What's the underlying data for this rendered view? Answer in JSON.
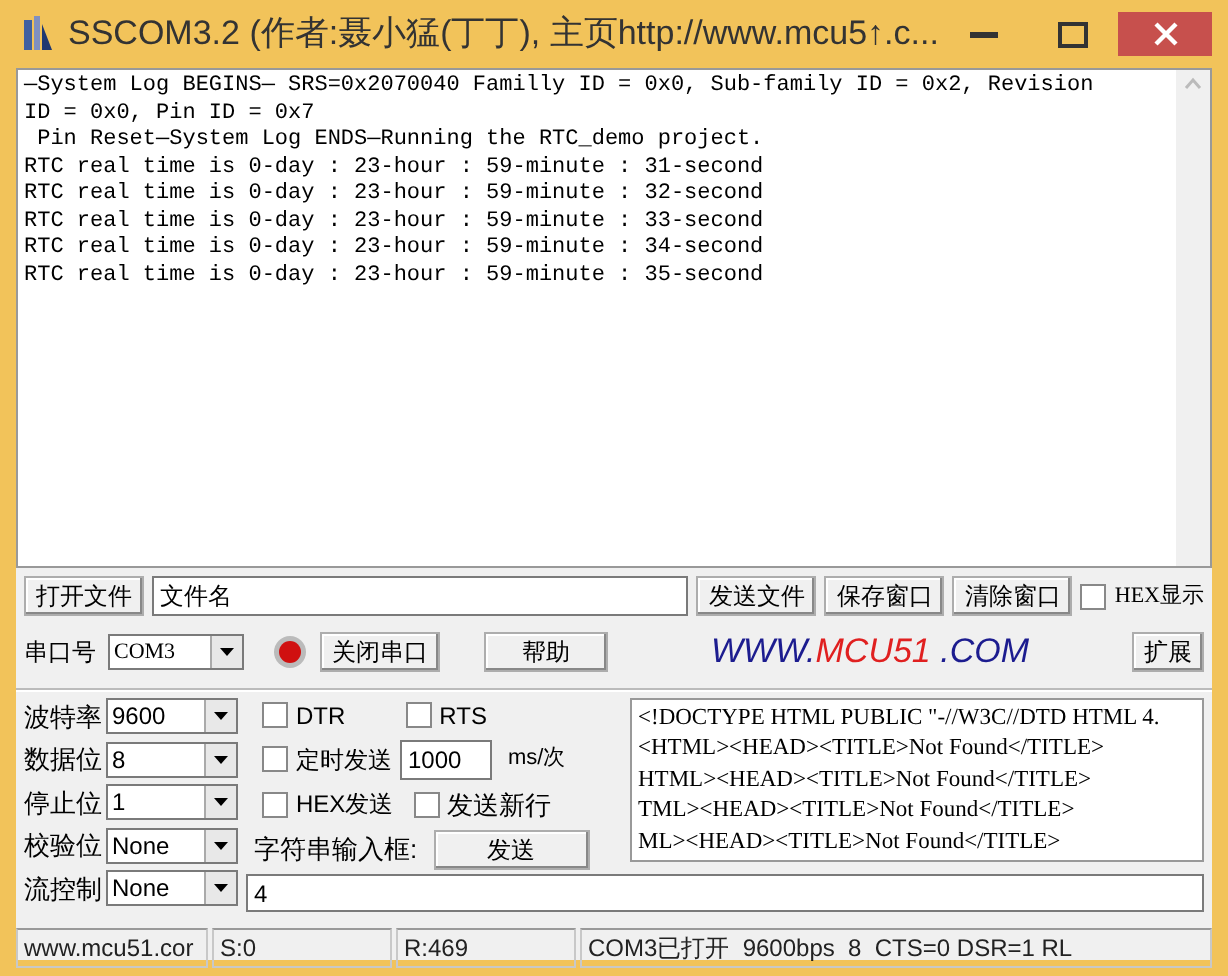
{
  "window": {
    "title": "SSCOM3.2 (作者:聂小猛(丁丁), 主页http://www.mcu5↑.c..."
  },
  "log": {
    "lines": [
      "—System Log BEGINS— SRS=0x2070040 Familly ID = 0x0, Sub-family ID = 0x2, Revision",
      "ID = 0x0, Pin ID = 0x7",
      " Pin Reset—System Log ENDS—Running the RTC_demo project.",
      "RTC real time is 0-day : 23-hour : 59-minute : 31-second",
      "RTC real time is 0-day : 23-hour : 59-minute : 32-second",
      "RTC real time is 0-day : 23-hour : 59-minute : 33-second",
      "RTC real time is 0-day : 23-hour : 59-minute : 34-second",
      "RTC real time is 0-day : 23-hour : 59-minute : 35-second"
    ]
  },
  "file_row": {
    "open_button": "打开文件",
    "filename": "文件名",
    "send_file_button": "发送文件",
    "save_button": "保存窗口",
    "clear_button": "清除窗口",
    "hex_display": {
      "label": "HEX显示",
      "checked": false
    }
  },
  "port_row": {
    "label": "串口号",
    "port": "COM3",
    "port_open": true,
    "close_button": "关闭串口",
    "help_button": "帮助",
    "logo": [
      {
        "text": "WWW.",
        "color": "#1c1c8f"
      },
      {
        "text": "MCU51",
        "color": "#e02020"
      },
      {
        "text": " .COM",
        "color": "#1c1c8f"
      }
    ],
    "expand_button": "扩展"
  },
  "settings": [
    {
      "label": "波特率",
      "value": "9600"
    },
    {
      "label": "数据位",
      "value": "8"
    },
    {
      "label": "停止位",
      "value": "1"
    },
    {
      "label": "校验位",
      "value": "None"
    },
    {
      "label": "流控制",
      "value": "None"
    }
  ],
  "options": {
    "dtr": {
      "label": "DTR",
      "checked": false
    },
    "rts": {
      "label": "RTS",
      "checked": false
    },
    "timed_send": {
      "label": "定时发送",
      "checked": false
    },
    "interval": "1000",
    "interval_unit": "ms/次",
    "hex_send": {
      "label": "HEX发送",
      "checked": false
    },
    "send_newline": {
      "label": "发送新行",
      "checked": false
    },
    "input_label": "字符串输入框:",
    "send_button": "发送"
  },
  "history": [
    "<!DOCTYPE HTML PUBLIC \"-//W3C//DTD HTML 4.",
    "<HTML><HEAD><TITLE>Not Found</TITLE>",
    "HTML><HEAD><TITLE>Not Found</TITLE>",
    "TML><HEAD><TITLE>Not Found</TITLE>",
    "ML><HEAD><TITLE>Not Found</TITLE>"
  ],
  "input": "4",
  "status_bar": [
    "www.mcu51.cor",
    "S:0",
    "R:469",
    "COM3已打开  9600bps  8  CTS=0 DSR=1 RL"
  ]
}
